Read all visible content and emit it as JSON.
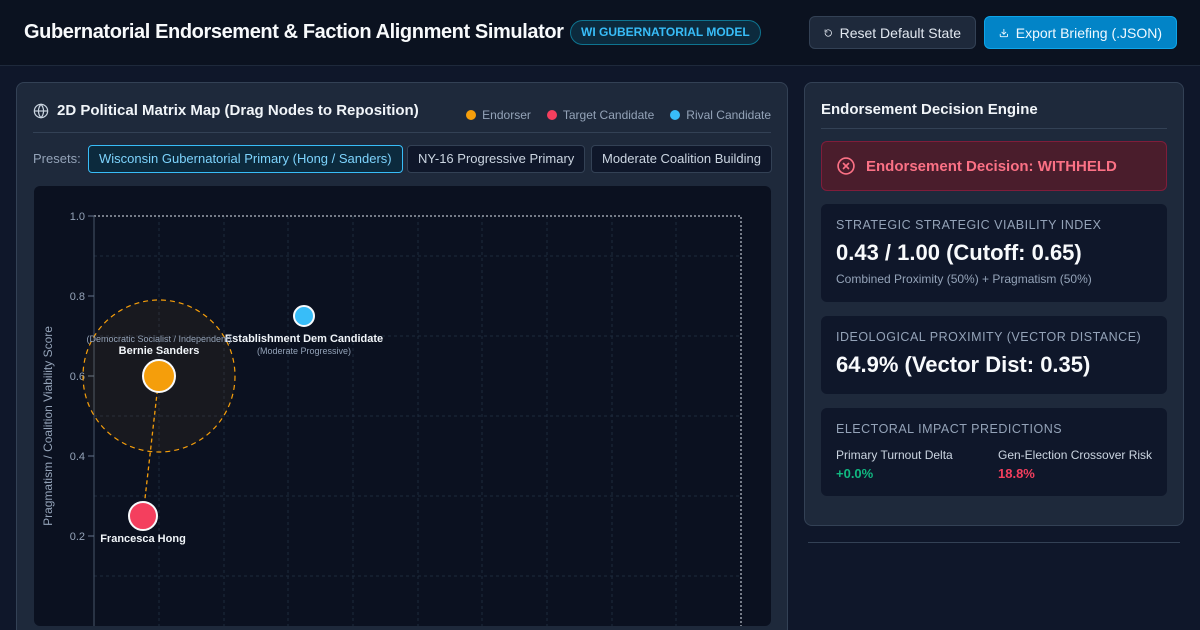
{
  "header": {
    "title": "Gubernatorial Endorsement & Faction Alignment Simulator",
    "badge": "WI GUBERNATORIAL MODEL",
    "reset_label": "Reset Default State",
    "export_label": "Export Briefing (.JSON)"
  },
  "map": {
    "title": "2D Political Matrix Map (Drag Nodes to Reposition)",
    "legend": [
      {
        "label": "Endorser",
        "color": "#f59e0b"
      },
      {
        "label": "Target Candidate",
        "color": "#f43f5e"
      },
      {
        "label": "Rival Candidate",
        "color": "#38bdf8"
      }
    ],
    "presets_label": "Presets:",
    "presets": [
      "Wisconsin Gubernatorial Primary (Hong / Sanders)",
      "NY-16 Progressive Primary",
      "Moderate Coalition Building"
    ],
    "y_axis_label": "Pragmatism / Coalition Viability Score",
    "y_ticks": [
      "1.0",
      "0.8",
      "0.6",
      "0.4",
      "0.2"
    ],
    "nodes": [
      {
        "name": "Bernie Sanders",
        "subtitle": "(Democratic Socialist / Independent)",
        "role": "endorser",
        "pragmatism": 0.6
      },
      {
        "name": "Establishment Dem Candidate",
        "subtitle": "(Moderate Progressive)",
        "role": "rival",
        "pragmatism": 0.75
      },
      {
        "name": "Francesca Hong",
        "subtitle": "",
        "role": "target",
        "pragmatism": 0.25
      }
    ]
  },
  "engine": {
    "title": "Endorsement Decision Engine",
    "decision": "Endorsement Decision: WITHHELD",
    "viability": {
      "label": "STRATEGIC STRATEGIC VIABILITY INDEX",
      "value": "0.43 / 1.00 (Cutoff: 0.65)",
      "sub": "Combined Proximity (50%) + Pragmatism (50%)"
    },
    "proximity": {
      "label": "IDEOLOGICAL PROXIMITY (VECTOR DISTANCE)",
      "value": "64.9% (Vector Dist: 0.35)"
    },
    "electoral": {
      "label": "ELECTORAL IMPACT PREDICTIONS",
      "turnout_label": "Primary Turnout Delta",
      "turnout_value": "+0.0%",
      "turnout_color": "#10b981",
      "crossover_label": "Gen-Election Crossover Risk",
      "crossover_value": "18.8%",
      "crossover_color": "#f43f5e"
    }
  }
}
